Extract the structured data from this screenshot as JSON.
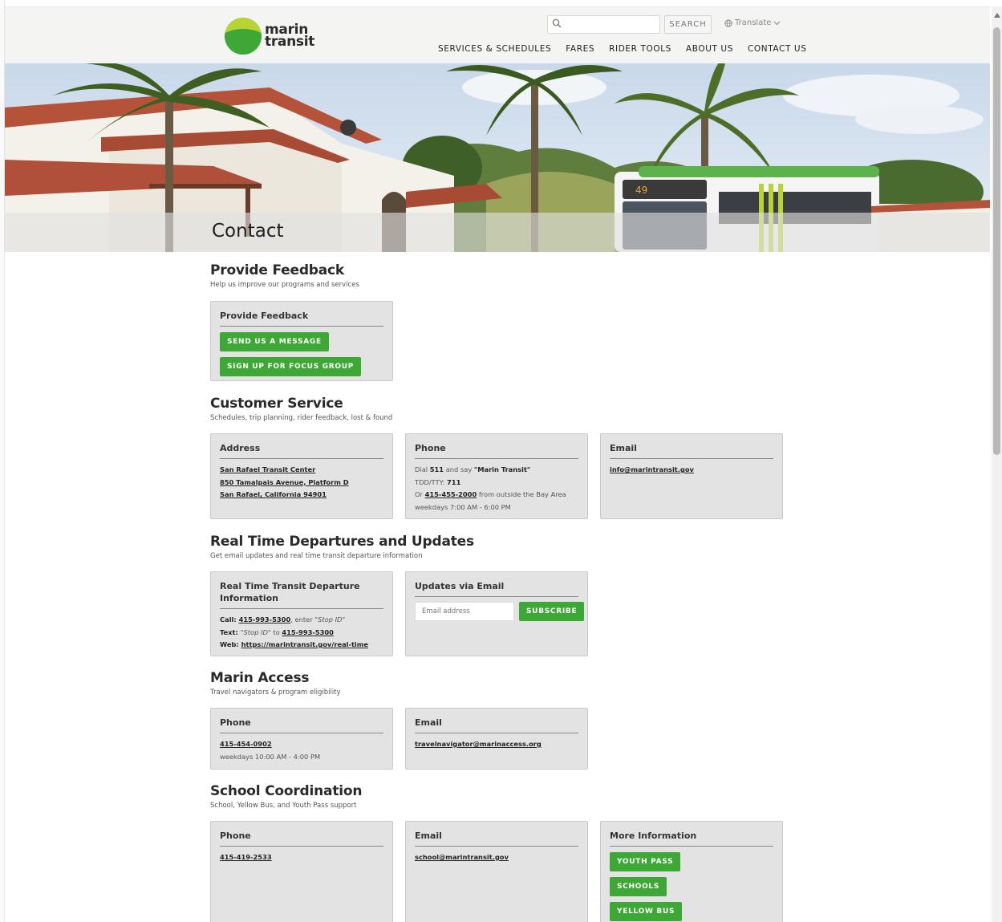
{
  "header": {
    "logo_line1": "marin",
    "logo_line2": "transit",
    "search_placeholder": "",
    "search_button": "SEARCH",
    "translate_label": "Translate",
    "nav": [
      {
        "label": "SERVICES & SCHEDULES"
      },
      {
        "label": "FARES"
      },
      {
        "label": "RIDER TOOLS"
      },
      {
        "label": "ABOUT US"
      },
      {
        "label": "CONTACT US"
      }
    ]
  },
  "hero": {
    "title": "Contact",
    "bus_route_number": "49"
  },
  "sections": {
    "feedback": {
      "title": "Provide Feedback",
      "subtitle": "Help us improve our programs and services",
      "card": {
        "title": "Provide Feedback",
        "buttons": [
          "SEND US A MESSAGE",
          "SIGN UP FOR FOCUS GROUP"
        ]
      }
    },
    "customer_service": {
      "title": "Customer Service",
      "subtitle": "Schedules, trip planning, rider feedback, lost & found",
      "address_card": {
        "title": "Address",
        "line1": "San Rafael Transit Center",
        "line2": "850 Tamalpais Avenue, Platform D",
        "line3": "San Rafael, California 94901"
      },
      "phone_card": {
        "title": "Phone",
        "dial_pre": "Dial ",
        "dial_num": "511",
        "dial_mid": " and say ",
        "dial_say": "\"Marin Transit\"",
        "tdd_pre": "TDD/TTY: ",
        "tdd_num": "711",
        "or_pre": "Or ",
        "or_num": "415-455-2000",
        "or_post": " from outside the Bay Area",
        "hours": "weekdays 7:00 AM - 6:00 PM"
      },
      "email_card": {
        "title": "Email",
        "email": "info@marintransit.gov"
      }
    },
    "realtime": {
      "title": "Real Time Departures and Updates",
      "subtitle": "Get email updates and real time transit departure information",
      "info_card": {
        "title": "Real Time Transit Departure Information",
        "call_label": "Call: ",
        "call_num": "415-993-5300",
        "call_mid": ", enter ",
        "call_stop": "\"Stop ID\"",
        "text_label": "Text: ",
        "text_stop": "\"Stop ID\"",
        "text_mid": " to ",
        "text_num": "415-993-5300",
        "web_label": "Web: ",
        "web_url": "https://marintransit.gov/real-time"
      },
      "email_card": {
        "title": "Updates via Email",
        "placeholder": "Email address",
        "button": "SUBSCRIBE"
      }
    },
    "marin_access": {
      "title": "Marin Access",
      "subtitle": "Travel navigators & program eligibility",
      "phone_card": {
        "title": "Phone",
        "number": "415-454-0902",
        "hours": "weekdays 10:00 AM - 4:00 PM"
      },
      "email_card": {
        "title": "Email",
        "email": "travelnavigator@marinaccess.org"
      }
    },
    "school": {
      "title": "School Coordination",
      "subtitle": "School, Yellow Bus, and Youth Pass support",
      "phone_card": {
        "title": "Phone",
        "number": "415-419-2533"
      },
      "email_card": {
        "title": "Email",
        "email": "school@marintransit.gov"
      },
      "more_card": {
        "title": "More Information",
        "buttons": [
          "YOUTH PASS",
          "SCHOOLS",
          "YELLOW BUS"
        ]
      }
    }
  },
  "colors": {
    "accent_green": "#3ea837",
    "logo_lime": "#b7d433",
    "card_bg": "#e3e3e3",
    "header_bg": "#f4f4f2"
  }
}
